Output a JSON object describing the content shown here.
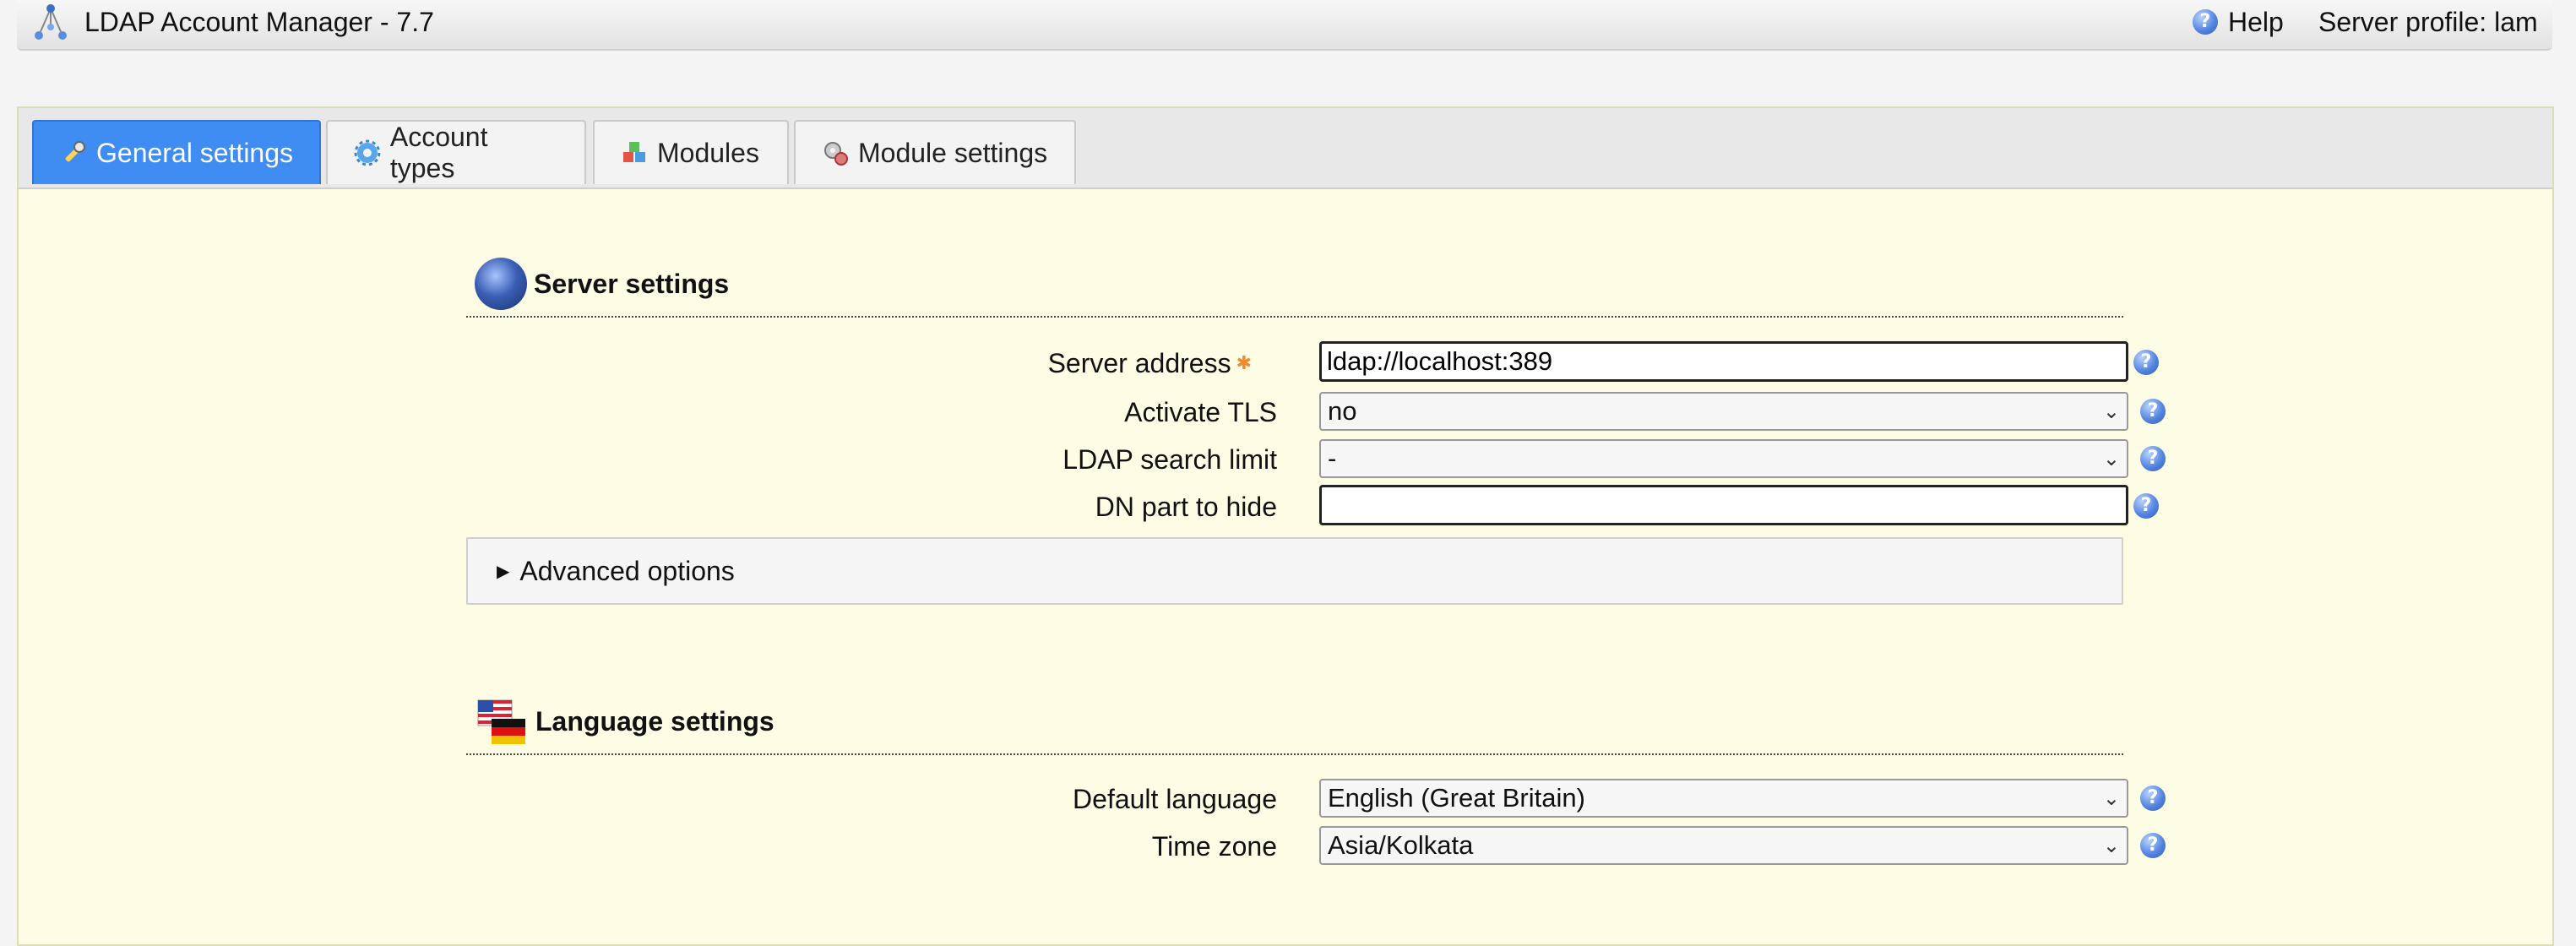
{
  "header": {
    "app_title": "LDAP Account Manager - 7.7",
    "help_label": "Help",
    "server_profile": "Server profile: lam"
  },
  "tabs": [
    {
      "label": "General settings",
      "icon": "wrench-icon",
      "active": true
    },
    {
      "label": "Account types",
      "icon": "gear-icon",
      "active": false
    },
    {
      "label": "Modules",
      "icon": "modules-icon",
      "active": false
    },
    {
      "label": "Module settings",
      "icon": "module-settings-icon",
      "active": false
    }
  ],
  "server_settings": {
    "title": "Server settings",
    "server_address_label": "Server address",
    "server_address_value": "ldap://localhost:389",
    "activate_tls_label": "Activate TLS",
    "activate_tls_value": "no",
    "search_limit_label": "LDAP search limit",
    "search_limit_value": "-",
    "dn_hide_label": "DN part to hide",
    "dn_hide_value": "",
    "advanced_label": "Advanced options"
  },
  "language_settings": {
    "title": "Language settings",
    "default_language_label": "Default language",
    "default_language_value": "English (Great Britain)",
    "time_zone_label": "Time zone",
    "time_zone_value": "Asia/Kolkata"
  },
  "colors": {
    "active_tab": "#3f8cf2",
    "panel_background": "#fdfde6",
    "required_marker": "#f08a2a"
  }
}
